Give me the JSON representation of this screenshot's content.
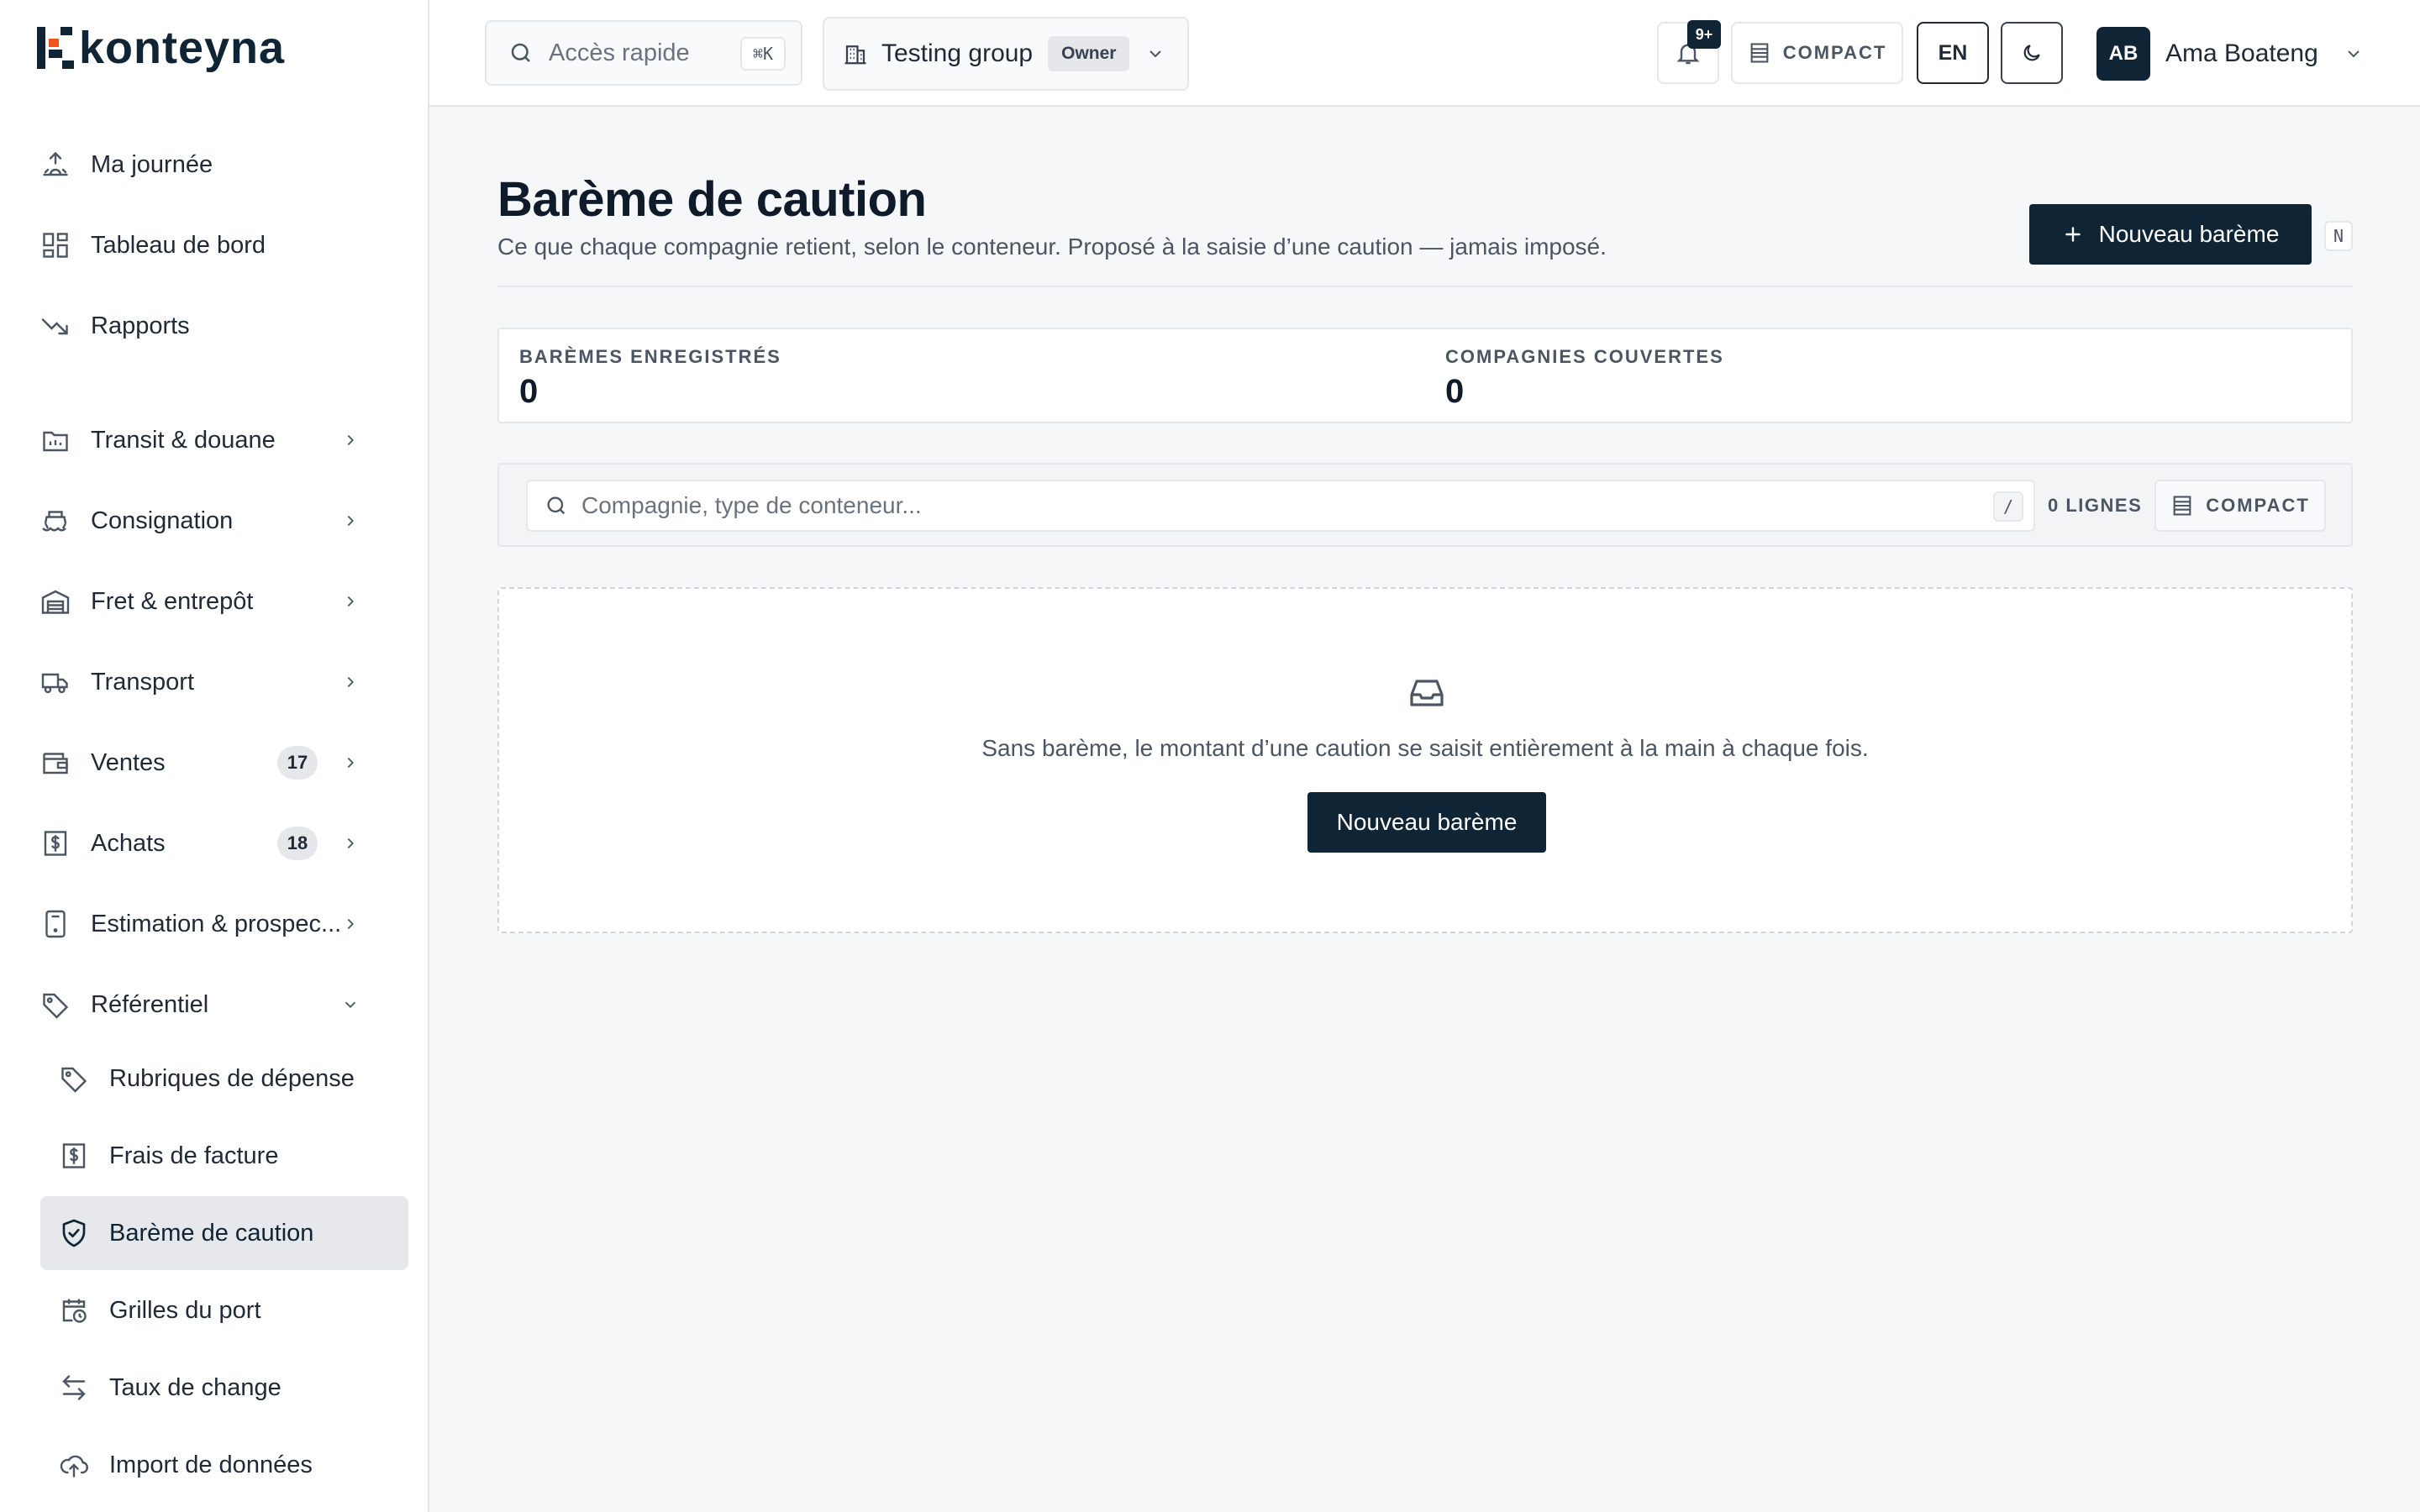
{
  "brand": {
    "name": "konteyna"
  },
  "sidebar": {
    "items": [
      {
        "label": "Ma journée",
        "icon": "sunrise-icon"
      },
      {
        "label": "Tableau de bord",
        "icon": "dashboard-icon"
      },
      {
        "label": "Rapports",
        "icon": "trend-down-icon"
      },
      {
        "label": "Transit & douane",
        "icon": "folder-icon"
      },
      {
        "label": "Consignation",
        "icon": "ship-icon"
      },
      {
        "label": "Fret & entrepôt",
        "icon": "warehouse-icon"
      },
      {
        "label": "Transport",
        "icon": "truck-icon"
      },
      {
        "label": "Ventes",
        "icon": "wallet-icon",
        "badge": "17"
      },
      {
        "label": "Achats",
        "icon": "dollar-receipt-icon",
        "badge": "18"
      },
      {
        "label": "Estimation & prospec...",
        "icon": "calculator-icon"
      },
      {
        "label": "Référentiel",
        "icon": "tag-icon"
      }
    ],
    "subitems": [
      {
        "label": "Rubriques de dépense",
        "icon": "tag-icon"
      },
      {
        "label": "Frais de facture",
        "icon": "dollar-receipt-icon"
      },
      {
        "label": "Barème de caution",
        "icon": "shield-check-icon",
        "active": true
      },
      {
        "label": "Grilles du port",
        "icon": "calendar-clock-icon"
      },
      {
        "label": "Taux de change",
        "icon": "arrows-swap-icon"
      },
      {
        "label": "Import de données",
        "icon": "cloud-upload-icon"
      }
    ]
  },
  "topbar": {
    "search_label": "Accès rapide",
    "search_kbd": "⌘K",
    "group_name": "Testing group",
    "group_role": "Owner",
    "notifications_badge": "9+",
    "compact_label": "COMPACT",
    "lang": "EN",
    "user_initials": "AB",
    "user_name": "Ama Boateng"
  },
  "page": {
    "title": "Barème de caution",
    "subtitle": "Ce que chaque compagnie retient, selon le conteneur. Proposé à la saisie d’une caution — jamais imposé.",
    "new_button": "Nouveau barème",
    "new_kbd": "N"
  },
  "stats": [
    {
      "label": "BARÈMES ENREGISTRÉS",
      "value": "0"
    },
    {
      "label": "COMPAGNIES COUVERTES",
      "value": "0"
    }
  ],
  "filter": {
    "placeholder": "Compagnie, type de conteneur...",
    "kbd": "/",
    "row_count": "0 LIGNES",
    "compact_label": "COMPACT"
  },
  "empty": {
    "message": "Sans barème, le montant d’une caution se saisit entièrement à la main à chaque fois.",
    "button": "Nouveau barème"
  },
  "colors": {
    "brand": "#0f2434",
    "accent": "#f0551f",
    "background": "#f6f7f9"
  }
}
